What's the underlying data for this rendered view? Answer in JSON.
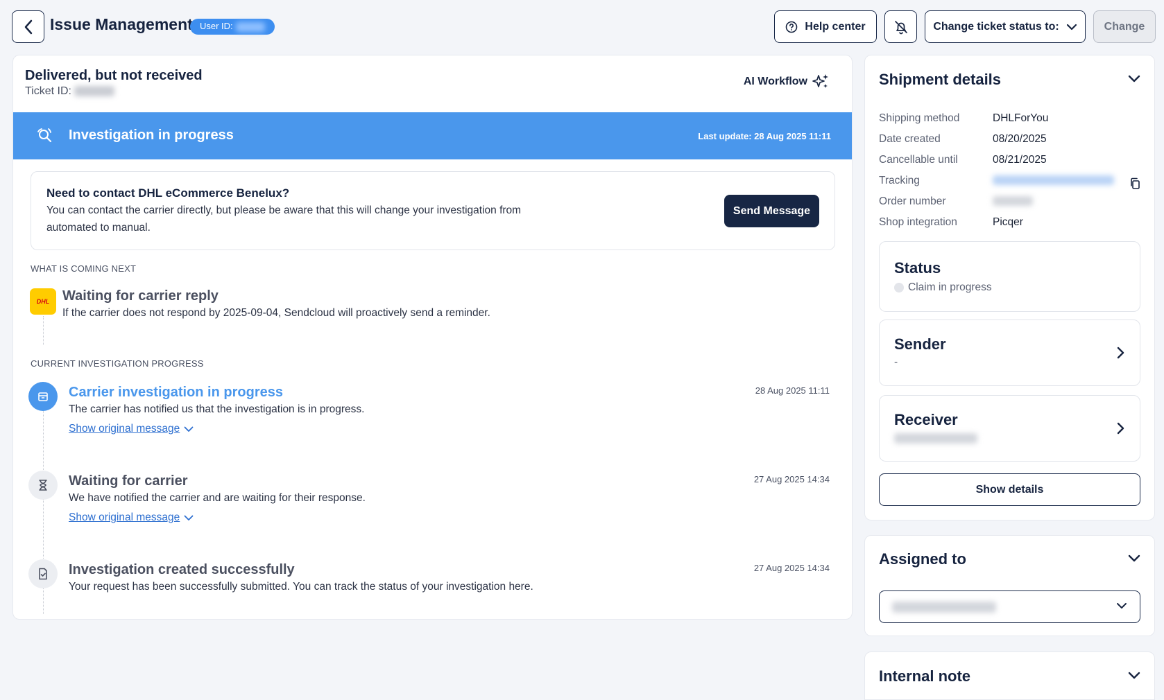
{
  "header": {
    "title": "Issue Management",
    "user_id_label": "User ID:",
    "help_label": "Help center",
    "status_select_label": "Change ticket status to:",
    "change_label": "Change"
  },
  "ticket": {
    "title": "Delivered, but not received",
    "id_label": "Ticket ID:",
    "ai_workflow_label": "AI Workflow"
  },
  "banner": {
    "title": "Investigation in progress",
    "last_update": "Last update: 28 Aug 2025 11:11"
  },
  "contact": {
    "title": "Need to contact DHL eCommerce Benelux?",
    "description": "You can contact the carrier directly, but please be aware that this will change your investigation from automated to manual.",
    "button_label": "Send Message"
  },
  "next": {
    "section_label": "WHAT IS COMING NEXT",
    "logo_text": "DHL",
    "title": "Waiting for carrier reply",
    "description": "If the carrier does not respond by 2025-09-04, Sendcloud will proactively send a reminder."
  },
  "progress": {
    "section_label": "CURRENT INVESTIGATION PROGRESS",
    "steps": [
      {
        "title": "Carrier investigation in progress",
        "description": "The carrier has notified us that the investigation is in progress.",
        "link": "Show original message",
        "date": "28 Aug 2025 11:11",
        "icon": "box-icon"
      },
      {
        "title": "Waiting for carrier",
        "description": "We have notified the carrier and are waiting for their response.",
        "link": "Show original message",
        "date": "27 Aug 2025 14:34",
        "icon": "hourglass-icon"
      },
      {
        "title": "Investigation created successfully",
        "description": "Your request has been successfully submitted. You can track the status of your investigation here.",
        "date": "27 Aug 2025 14:34",
        "icon": "document-check-icon"
      }
    ]
  },
  "shipment": {
    "title": "Shipment details",
    "rows": [
      {
        "label": "Shipping method",
        "value": "DHLForYou"
      },
      {
        "label": "Date created",
        "value": "08/20/2025"
      },
      {
        "label": "Cancellable until",
        "value": "08/21/2025"
      },
      {
        "label": "Tracking",
        "value": ""
      },
      {
        "label": "Order number",
        "value": ""
      },
      {
        "label": "Shop integration",
        "value": "Picqer"
      }
    ],
    "status": {
      "title": "Status",
      "value": "Claim in progress"
    },
    "sender": {
      "title": "Sender",
      "value": "-"
    },
    "receiver": {
      "title": "Receiver"
    },
    "show_details_label": "Show details"
  },
  "assigned": {
    "title": "Assigned to"
  },
  "internal_note": {
    "title": "Internal note"
  },
  "colors": {
    "accent": "#4a97ec",
    "primary_dark": "#172644",
    "link": "#2d6fd0",
    "dhl_yellow": "#ffcc00",
    "dhl_red": "#d40511"
  }
}
